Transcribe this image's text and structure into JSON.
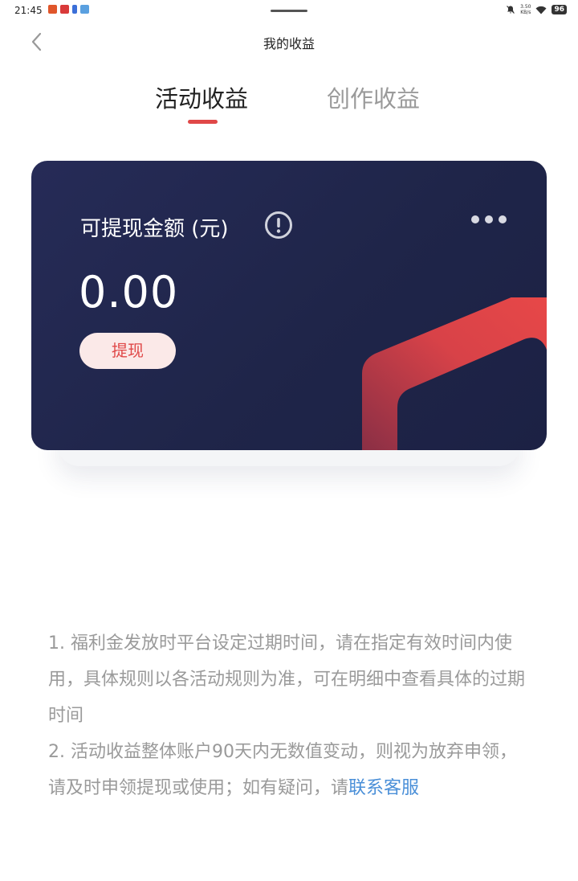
{
  "status_bar": {
    "time": "21:45",
    "net_speed_value": "3.50",
    "net_speed_unit": "KB/s",
    "battery": "96"
  },
  "header": {
    "title": "我的收益"
  },
  "tabs": [
    {
      "label": "活动收益",
      "active": true
    },
    {
      "label": "创作收益",
      "active": false
    }
  ],
  "card": {
    "label": "可提现金额 (元)",
    "amount": "0.00",
    "withdraw_label": "提现"
  },
  "notes": {
    "line1": "1. 福利金发放时平台设定过期时间，请在指定有效时间内使用，具体规则以各活动规则为准，可在明细中查看具体的过期时间",
    "line2_text": "2. 活动收益整体账户90天内无数值变动，则视为放弃申领，请及时申领提现或使用；如有疑问，请",
    "line2_link": "联系客服"
  },
  "colors": {
    "accent": "#e04848",
    "card_bg": "#232850",
    "link": "#4a8fd8",
    "note_text": "#9a9a9a"
  },
  "icons": [
    "back-chevron-icon",
    "info-exclamation-icon",
    "more-dots-icon"
  ]
}
